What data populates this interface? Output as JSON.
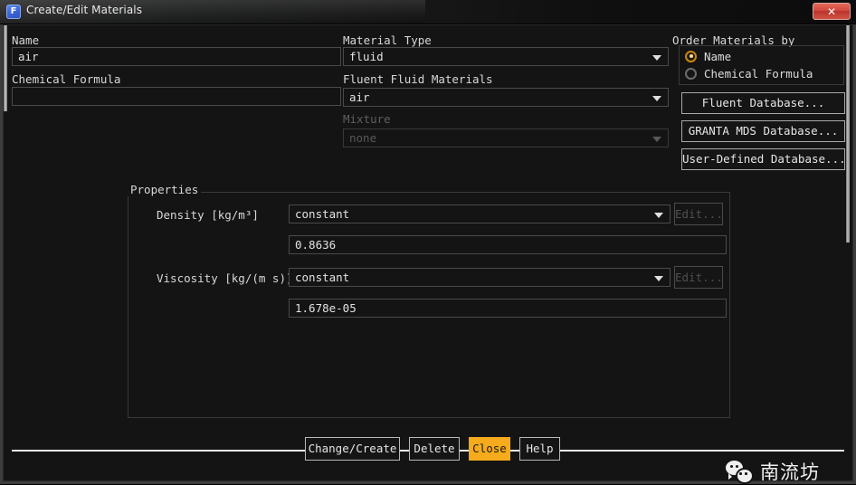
{
  "window": {
    "title": "Create/Edit Materials",
    "app_icon": "fluent-f-icon",
    "close_label": "✕"
  },
  "left_panel": {
    "name_label": "Name",
    "name_value": "air",
    "formula_label": "Chemical Formula",
    "formula_value": ""
  },
  "middle_panel": {
    "material_type_label": "Material Type",
    "material_type_value": "fluid",
    "fluent_materials_label": "Fluent Fluid Materials",
    "fluent_materials_value": "air",
    "mixture_label": "Mixture",
    "mixture_value": "none"
  },
  "order_by": {
    "group_label": "Order Materials by",
    "options": [
      {
        "label": "Name",
        "selected": true
      },
      {
        "label": "Chemical Formula",
        "selected": false
      }
    ]
  },
  "database_buttons": [
    {
      "label": "Fluent Database..."
    },
    {
      "label": "GRANTA MDS Database..."
    },
    {
      "label": "User-Defined Database..."
    }
  ],
  "properties": {
    "group_label": "Properties",
    "rows": [
      {
        "label": "Density [kg/m³]",
        "method": "constant",
        "value": "0.8636",
        "edit_label": "Edit...",
        "edit_enabled": false
      },
      {
        "label": "Viscosity [kg/(m s)]",
        "method": "constant",
        "value": "1.678e-05",
        "edit_label": "Edit...",
        "edit_enabled": false
      }
    ]
  },
  "footer": {
    "buttons": [
      {
        "label": "Change/Create",
        "accent": false
      },
      {
        "label": "Delete",
        "accent": false
      },
      {
        "label": "Close",
        "accent": true
      },
      {
        "label": "Help",
        "accent": false
      }
    ]
  },
  "watermark": {
    "icon": "wechat-icon",
    "text": "南流坊"
  },
  "colors": {
    "accent": "#f5ab1b",
    "radio_selected": "#c8860f",
    "close_button": "#d4483c",
    "background": "#141414"
  }
}
